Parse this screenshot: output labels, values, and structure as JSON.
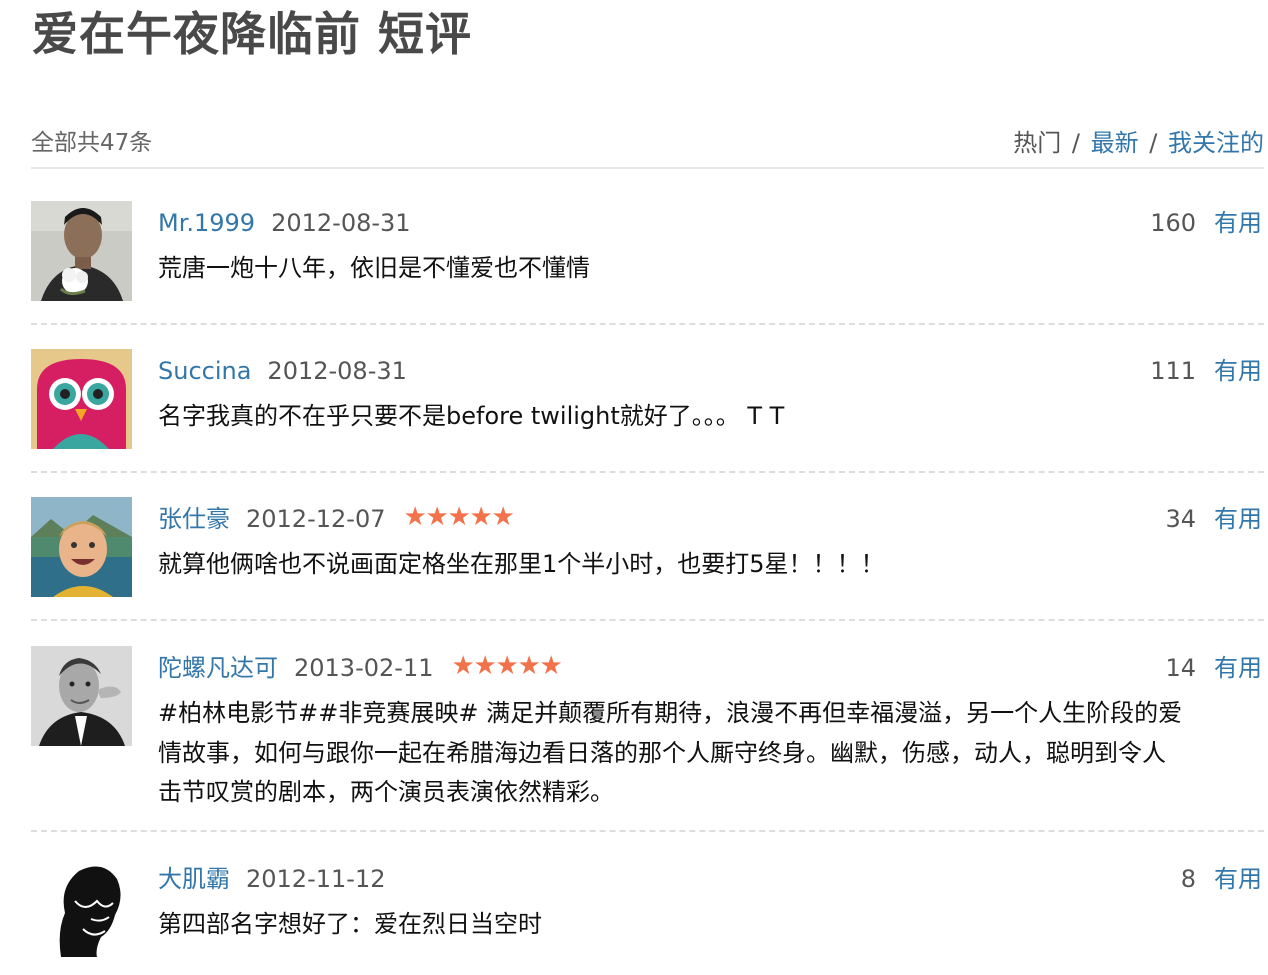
{
  "title": "爱在午夜降临前 短评",
  "summary": {
    "total": "全部共47条",
    "tabs": {
      "hot": "热门",
      "sep1": "/",
      "newest": "最新",
      "sep2": "/",
      "following": "我关注的"
    }
  },
  "comments": [
    {
      "user": "Mr.1999",
      "date": "2012-08-31",
      "stars": 0,
      "votes": "160",
      "useful": "有用",
      "text": "荒唐一炮十八年，依旧是不懂爱也不懂情",
      "avatar": "man-with-flower-avatar"
    },
    {
      "user": "Succina",
      "date": "2012-08-31",
      "stars": 0,
      "votes": "111",
      "useful": "有用",
      "text": "名字我真的不在乎只要不是before twilight就好了。。。 T T",
      "avatar": "owl-avatar"
    },
    {
      "user": "张仕豪",
      "date": "2012-12-07",
      "stars": 5,
      "votes": "34",
      "useful": "有用",
      "text": "就算他俩啥也不说画面定格坐在那里1个半小时，也要打5星！！！！",
      "avatar": "smiling-boy-avatar"
    },
    {
      "user": "陀螺凡达可",
      "date": "2013-02-11",
      "stars": 5,
      "votes": "14",
      "useful": "有用",
      "text": "#柏林电影节##非竞赛展映# 满足并颠覆所有期待，浪漫不再但幸福漫溢，另一个人生阶段的爱情故事，如何与跟你一起在希腊海边看日落的那个人厮守终身。幽默，伤感，动人，聪明到令人击节叹赏的剧本，两个演员表演依然精彩。",
      "avatar": "bw-portrait-avatar"
    },
    {
      "user": "大肌霸",
      "date": "2012-11-12",
      "stars": 0,
      "votes": "8",
      "useful": "有用",
      "text": "第四部名字想好了：爱在烈日当空时",
      "avatar": "sunglasses-silhouette-avatar"
    }
  ],
  "colors": {
    "link": "#3377aa",
    "star": "#f2734b",
    "divider": "#dddddd",
    "title": "#494949"
  }
}
